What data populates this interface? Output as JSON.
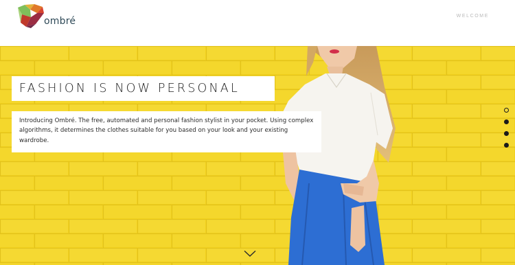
{
  "brand": {
    "name": "ombré"
  },
  "nav": {
    "welcome": "WELCOME"
  },
  "hero": {
    "headline": "FASHION IS NOW PERSONAL",
    "intro": "Introducing Ombré. The free, automated and personal fashion stylist in your pocket. Using complex algorithms, it determines the clothes suitable for you based on your look and your existing wardrobe."
  },
  "pager": {
    "count": 4,
    "active_index": 0
  },
  "icons": {
    "logo": "ombre-logo-icon",
    "scroll": "chevron-down-icon"
  },
  "colors": {
    "background": "#f2d21e",
    "skirt": "#2d6ed3",
    "shirt": "#f6f4ef",
    "brand_text": "#2f4a58"
  }
}
